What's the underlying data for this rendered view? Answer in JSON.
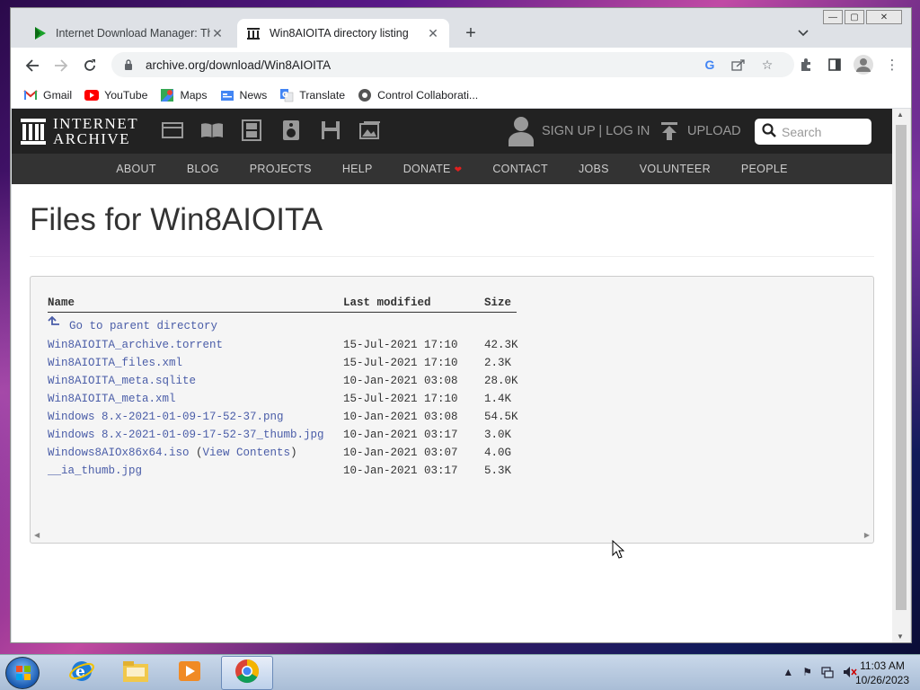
{
  "browser": {
    "tabs": [
      {
        "title": "Internet Download Manager: The",
        "favicon": "idm-play-icon",
        "active": false
      },
      {
        "title": "Win8AIOITA directory listing",
        "favicon": "archive-icon",
        "active": true
      }
    ],
    "new_tab": "+",
    "url": "archive.org/download/Win8AIOITA"
  },
  "bookmarks": [
    {
      "label": "Gmail",
      "icon": "gmail-icon"
    },
    {
      "label": "YouTube",
      "icon": "youtube-icon"
    },
    {
      "label": "Maps",
      "icon": "maps-icon"
    },
    {
      "label": "News",
      "icon": "news-icon"
    },
    {
      "label": "Translate",
      "icon": "translate-icon"
    },
    {
      "label": "Control Collaborati...",
      "icon": "control-collab-icon"
    }
  ],
  "site": {
    "logo_line1": "INTERNET",
    "logo_line2": "ARCHIVE",
    "auth": "SIGN UP | LOG IN",
    "upload": "UPLOAD",
    "search_placeholder": "Search",
    "nav": [
      "ABOUT",
      "BLOG",
      "PROJECTS",
      "HELP",
      "DONATE",
      "CONTACT",
      "JOBS",
      "VOLUNTEER",
      "PEOPLE"
    ]
  },
  "page": {
    "title": "Files for Win8AIOITA",
    "headers": {
      "name": "Name",
      "modified": "Last modified",
      "size": "Size"
    },
    "parent": "Go to parent directory",
    "files": [
      {
        "name": "Win8AIOITA_archive.torrent",
        "modified": "15-Jul-2021 17:10",
        "size": "42.3K"
      },
      {
        "name": "Win8AIOITA_files.xml",
        "modified": "15-Jul-2021 17:10",
        "size": "2.3K"
      },
      {
        "name": "Win8AIOITA_meta.sqlite",
        "modified": "10-Jan-2021 03:08",
        "size": "28.0K"
      },
      {
        "name": "Win8AIOITA_meta.xml",
        "modified": "15-Jul-2021 17:10",
        "size": "1.4K"
      },
      {
        "name": "Windows 8.x-2021-01-09-17-52-37.png",
        "modified": "10-Jan-2021 03:08",
        "size": "54.5K"
      },
      {
        "name": "Windows 8.x-2021-01-09-17-52-37_thumb.jpg",
        "modified": "10-Jan-2021 03:17",
        "size": "3.0K"
      },
      {
        "name": "Windows8AIOx86x64.iso",
        "extra_before": " (",
        "extra_link": "View Contents",
        "extra_after": ")",
        "modified": "10-Jan-2021 03:07",
        "size": "4.0G"
      },
      {
        "name": "__ia_thumb.jpg",
        "modified": "10-Jan-2021 03:17",
        "size": "5.3K"
      }
    ]
  },
  "taskbar": {
    "time": "11:03 AM",
    "date": "10/26/2023"
  }
}
